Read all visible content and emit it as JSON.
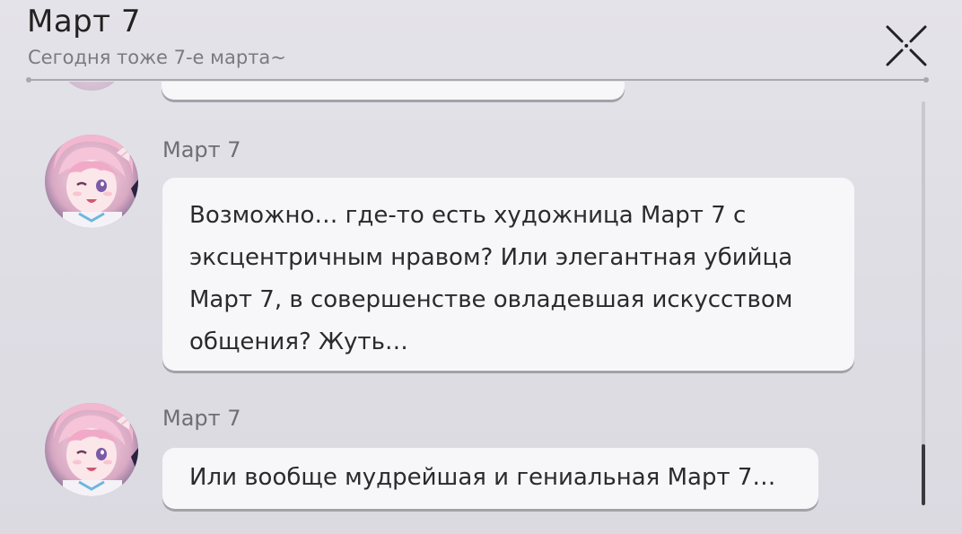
{
  "header": {
    "title": "Март 7",
    "subtitle": "Сегодня тоже 7-е марта~",
    "close_icon": "close-x-icon"
  },
  "messages": [
    {
      "sender": "Март 7",
      "avatar_icon": "march-7th-avatar",
      "text": "Возможно… где-то есть художница Март 7 с эксцентричным нравом? Или элегантная убийца Март 7, в совершенстве овладевшая искусством общения? Жуть…"
    },
    {
      "sender": "Март 7",
      "avatar_icon": "march-7th-avatar",
      "text": "Или вообще мудрейшая и гениальная Март 7…"
    }
  ],
  "colors": {
    "background": "#e2e1e7",
    "bubble": "#f7f7f9",
    "bubble_shadow": "#a3a2a9",
    "divider": "#a9a8ae",
    "scroll_thumb": "#3a3a3e"
  }
}
